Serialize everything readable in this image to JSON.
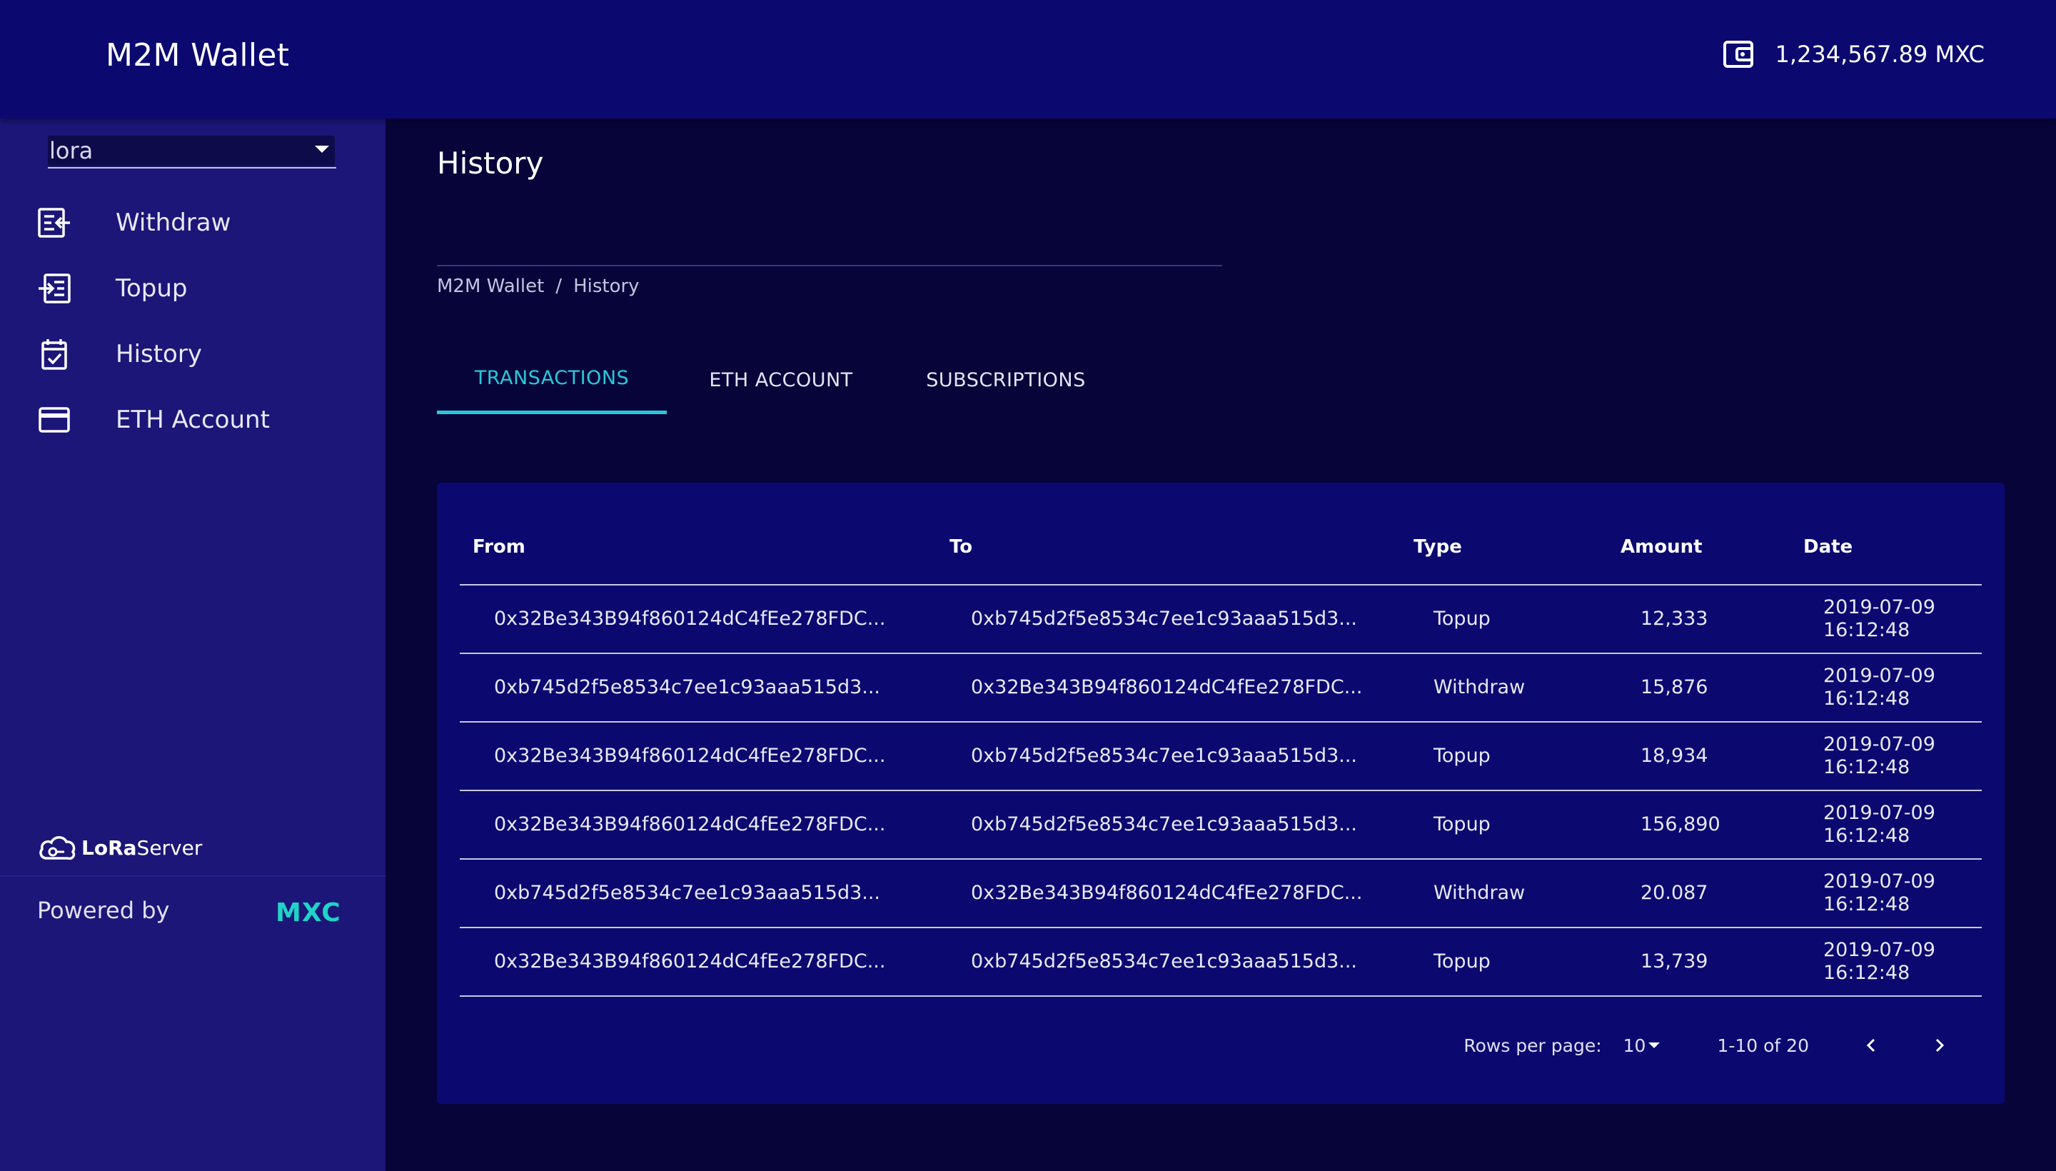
{
  "header": {
    "title": "M2M Wallet",
    "balance": "1,234,567.89 MXC",
    "wallet_icon": "wallet-icon"
  },
  "sidebar": {
    "org_select": {
      "value": "lora"
    },
    "items": [
      {
        "label": "Withdraw",
        "icon": "withdraw-icon"
      },
      {
        "label": "Topup",
        "icon": "topup-icon"
      },
      {
        "label": "History",
        "icon": "calendar-check-icon"
      },
      {
        "label": "ETH Account",
        "icon": "credit-card-icon"
      }
    ],
    "lora_logo": {
      "bold": "LoRa",
      "regular": "Server"
    },
    "powered_by": "Powered by",
    "mxc_logo": "MXC"
  },
  "main": {
    "title": "History",
    "breadcrumb": {
      "root": "M2M Wallet",
      "separator": "/",
      "current": "History"
    },
    "tabs": [
      {
        "label": "TRANSACTIONS",
        "active": true
      },
      {
        "label": "ETH ACCOUNT",
        "active": false
      },
      {
        "label": "SUBSCRIPTIONS",
        "active": false
      }
    ],
    "table": {
      "columns": {
        "from": "From",
        "to": "To",
        "type": "Type",
        "amount": "Amount",
        "date": "Date"
      },
      "rows": [
        {
          "from": "0x32Be343B94f860124dC4fEe278FDC...",
          "to": "0xb745d2f5e8534c7ee1c93aaa515d3...",
          "type": "Topup",
          "amount": "12,333",
          "date": "2019-07-09",
          "time": "16:12:48"
        },
        {
          "from": "0xb745d2f5e8534c7ee1c93aaa515d3...",
          "to": "0x32Be343B94f860124dC4fEe278FDC...",
          "type": "Withdraw",
          "amount": "15,876",
          "date": "2019-07-09",
          "time": "16:12:48"
        },
        {
          "from": "0x32Be343B94f860124dC4fEe278FDC...",
          "to": "0xb745d2f5e8534c7ee1c93aaa515d3...",
          "type": "Topup",
          "amount": "18,934",
          "date": "2019-07-09",
          "time": "16:12:48"
        },
        {
          "from": "0x32Be343B94f860124dC4fEe278FDC...",
          "to": "0xb745d2f5e8534c7ee1c93aaa515d3...",
          "type": "Topup",
          "amount": "156,890",
          "date": "2019-07-09",
          "time": "16:12:48"
        },
        {
          "from": "0xb745d2f5e8534c7ee1c93aaa515d3...",
          "to": "0x32Be343B94f860124dC4fEe278FDC...",
          "type": "Withdraw",
          "amount": "20.087",
          "date": "2019-07-09",
          "time": "16:12:48"
        },
        {
          "from": "0x32Be343B94f860124dC4fEe278FDC...",
          "to": "0xb745d2f5e8534c7ee1c93aaa515d3...",
          "type": "Topup",
          "amount": "13,739",
          "date": "2019-07-09",
          "time": "16:12:48"
        }
      ]
    },
    "pagination": {
      "rows_per_page_label": "Rows per page:",
      "rows_per_page": "10",
      "range": "1-10 of 20"
    }
  },
  "colors": {
    "topbar": "#0b0870",
    "sidebar": "#1c1678",
    "background": "#07043a",
    "accent": "#27c9d8",
    "mxc": "#1fd3c8"
  }
}
